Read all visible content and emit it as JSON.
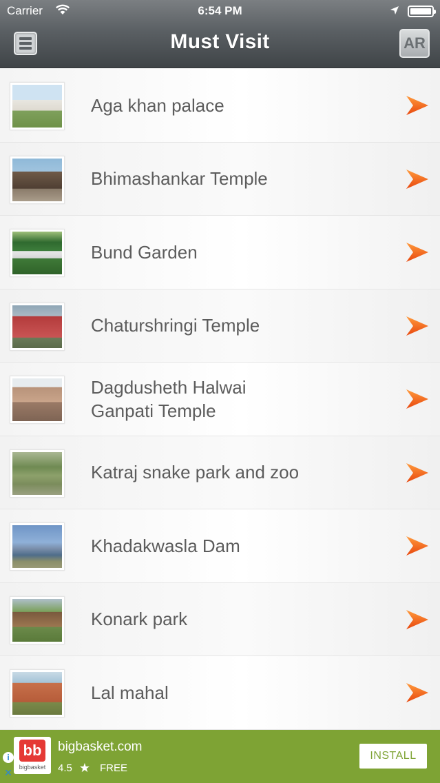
{
  "status_bar": {
    "carrier": "Carrier",
    "time": "6:54 PM"
  },
  "nav": {
    "title": "Must Visit",
    "ar_label": "AR"
  },
  "places": [
    {
      "name": "Aga khan palace"
    },
    {
      "name": "Bhimashankar Temple"
    },
    {
      "name": "Bund Garden"
    },
    {
      "name": "Chaturshringi Temple"
    },
    {
      "name": "Dagdusheth Halwai Ganpati Temple"
    },
    {
      "name": "Katraj snake park and zoo"
    },
    {
      "name": "Khadakwasla Dam"
    },
    {
      "name": "Konark park"
    },
    {
      "name": "Lal mahal"
    }
  ],
  "ad": {
    "logo_text": "bb",
    "logo_caption": "bigbasket",
    "app_name": "bigbasket.com",
    "rating": "4.5",
    "price": "FREE",
    "install_label": "INSTALL"
  },
  "colors": {
    "arrow_orange": "#f26a1b",
    "ad_green": "#7ea334",
    "text_gray": "#5c5c5c"
  }
}
